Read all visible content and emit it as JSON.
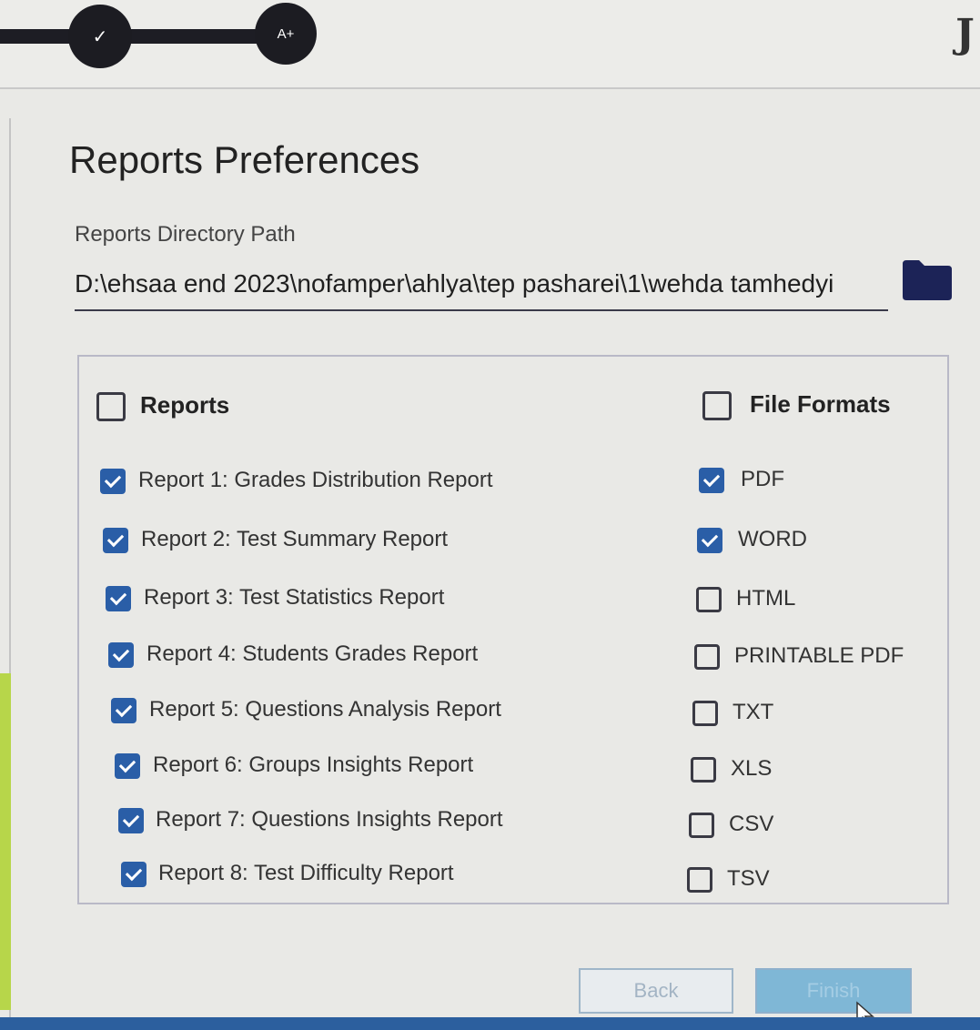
{
  "stepper": {
    "step1_symbol": "✓",
    "step2_label": "A+"
  },
  "title": "Reports Preferences",
  "path": {
    "label": "Reports Directory Path",
    "value": "D:\\ehsaa end 2023\\nofamper\\ahlya\\tep pasharei\\1\\wehda tamhedyi"
  },
  "reports": {
    "header": "Reports",
    "header_checked": false,
    "items": [
      {
        "label": "Report 1: Grades Distribution Report",
        "checked": true
      },
      {
        "label": "Report 2: Test Summary Report",
        "checked": true
      },
      {
        "label": "Report 3: Test Statistics Report",
        "checked": true
      },
      {
        "label": "Report 4: Students Grades Report",
        "checked": true
      },
      {
        "label": "Report 5: Questions Analysis Report",
        "checked": true
      },
      {
        "label": "Report 6: Groups Insights Report",
        "checked": true
      },
      {
        "label": "Report 7: Questions Insights Report",
        "checked": true
      },
      {
        "label": "Report 8: Test Difficulty Report",
        "checked": true
      }
    ]
  },
  "formats": {
    "header": "File Formats",
    "header_checked": false,
    "items": [
      {
        "label": "PDF",
        "checked": true
      },
      {
        "label": "WORD",
        "checked": true
      },
      {
        "label": "HTML",
        "checked": false
      },
      {
        "label": "PRINTABLE PDF",
        "checked": false
      },
      {
        "label": "TXT",
        "checked": false
      },
      {
        "label": "XLS",
        "checked": false
      },
      {
        "label": "CSV",
        "checked": false
      },
      {
        "label": "TSV",
        "checked": false
      }
    ]
  },
  "buttons": {
    "back": "Back",
    "finish": "Finish"
  },
  "colors": {
    "accent": "#2a5ea7",
    "folder_icon": "#1c2357",
    "finish_button": "#7fb7d6"
  }
}
